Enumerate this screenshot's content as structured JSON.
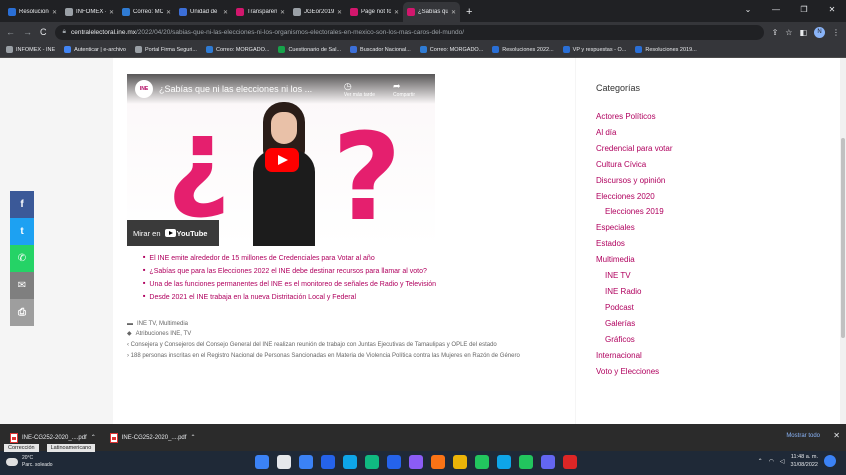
{
  "tabs": [
    {
      "title": "Resoluciones 20",
      "color": "#2a6fd6"
    },
    {
      "title": "INFOMEX - INE",
      "color": "#9aa0a6"
    },
    {
      "title": "Correo: MORGAI",
      "color": "#2f7bd3"
    },
    {
      "title": "Unidad de Transp",
      "color": "#3c6fd8"
    },
    {
      "title": "Transparencia | I",
      "color": "#d2176d"
    },
    {
      "title": "JGEor201910-31",
      "color": "#9aa0a6"
    },
    {
      "title": "Page not found",
      "color": "#d2176d"
    },
    {
      "title": "¿Sabías que ni la",
      "color": "#d2176d",
      "active": true
    }
  ],
  "address": {
    "domain": "centralelectoral.ine.mx",
    "path": "/2022/04/20/sabias-que-ni-las-elecciones-ni-los-organismos-electorales-en-mexico-son-los-mas-caros-del-mundo/",
    "profile_initial": "N"
  },
  "bookmarks": [
    {
      "label": "INFOMEX - INE",
      "color": "#9aa0a6"
    },
    {
      "label": "Autenticar | e-archivo",
      "color": "#4285f4"
    },
    {
      "label": "Portal Firma Seguri...",
      "color": "#9aa0a6"
    },
    {
      "label": "Correo: MORGADO...",
      "color": "#2f7bd3"
    },
    {
      "label": "Cuestionario de Sal...",
      "color": "#16a34a"
    },
    {
      "label": "Buscador Nacional...",
      "color": "#3c6fd8"
    },
    {
      "label": "Correo: MORGADO...",
      "color": "#2f7bd3"
    },
    {
      "label": "Resoluciones 2022...",
      "color": "#2a6fd6"
    },
    {
      "label": "VP y respuestas - O...",
      "color": "#2a6fd6"
    },
    {
      "label": "Resoluciones 2019...",
      "color": "#2a6fd6"
    }
  ],
  "video": {
    "channel_logo": "INE",
    "title": "¿Sabías que ni las elecciones ni los ...",
    "watch_later": "Ver más tarde",
    "share": "Compartir",
    "watch_on": "Mirar en",
    "youtube": "YouTube"
  },
  "related_links": [
    "El INE emite alrededor de 15 millones de Credenciales para Votar al año",
    "¿Sabías que para las Elecciones 2022 el INE debe destinar recursos para llamar al voto?",
    "Una de las funciones permanentes del INE es el monitoreo de señales de Radio y Televisión",
    "Desde 2021 el INE trabaja en la nueva Distritación Local y Federal"
  ],
  "post_meta": {
    "categories": "INE TV, Multimedia",
    "tags": "Atribuciones INE, TV",
    "prev_post": "Consejera y Consejeros del Consejo General del INE realizan reunión de trabajo con Juntas Ejecutivas de Tamaulipas y OPLE del estado",
    "next_post": "188 personas inscritas en el Registro Nacional de Personas Sancionadas en Materia de Violencia Política contra las Mujeres en Razón de Género"
  },
  "sidebar": {
    "title": "Categorías",
    "categories": [
      {
        "label": "Actores Políticos",
        "sub": false
      },
      {
        "label": "Al día",
        "sub": false
      },
      {
        "label": "Credencial para votar",
        "sub": false
      },
      {
        "label": "Cultura Cívica",
        "sub": false
      },
      {
        "label": "Discursos y opinión",
        "sub": false
      },
      {
        "label": "Elecciones 2020",
        "sub": false
      },
      {
        "label": "Elecciones 2019",
        "sub": true
      },
      {
        "label": "Especiales",
        "sub": false
      },
      {
        "label": "Estados",
        "sub": false
      },
      {
        "label": "Multimedia",
        "sub": false
      },
      {
        "label": "INE TV",
        "sub": true
      },
      {
        "label": "INE Radio",
        "sub": true
      },
      {
        "label": "Podcast",
        "sub": true
      },
      {
        "label": "Galerías",
        "sub": true
      },
      {
        "label": "Gráficos",
        "sub": true
      },
      {
        "label": "Internacional",
        "sub": false
      },
      {
        "label": "Voto y Elecciones",
        "sub": false
      }
    ]
  },
  "share_buttons": [
    {
      "icon": "facebook-icon",
      "glyph": "f",
      "color": "#3b5998"
    },
    {
      "icon": "twitter-icon",
      "glyph": "t",
      "color": "#1da1f2"
    },
    {
      "icon": "whatsapp-icon",
      "glyph": "✆",
      "color": "#25d366"
    },
    {
      "icon": "email-icon",
      "glyph": "✉",
      "color": "#7f7f7f"
    },
    {
      "icon": "print-icon",
      "glyph": "⎙",
      "color": "#9e9e9e"
    }
  ],
  "downloads": {
    "items": [
      "INE-CG252-2020_....pdf",
      "INE-CG252-2020_....pdf"
    ],
    "show_all": "Mostrar todo"
  },
  "taskbar": {
    "popup": [
      "Corrección",
      "Latinoamericano"
    ],
    "temperature": "20°C",
    "weather": "Parc. soleado",
    "time": "11:48 a. m.",
    "date": "31/08/2022",
    "app_colors": [
      "#3b82f6",
      "#e5e7eb",
      "#3b82f6",
      "#2563eb",
      "#0ea5e9",
      "#10b981",
      "#2563eb",
      "#8b5cf6",
      "#f97316",
      "#eab308",
      "#22c55e",
      "#0ea5e9",
      "#22c55e",
      "#6366f1",
      "#dc2626"
    ]
  }
}
